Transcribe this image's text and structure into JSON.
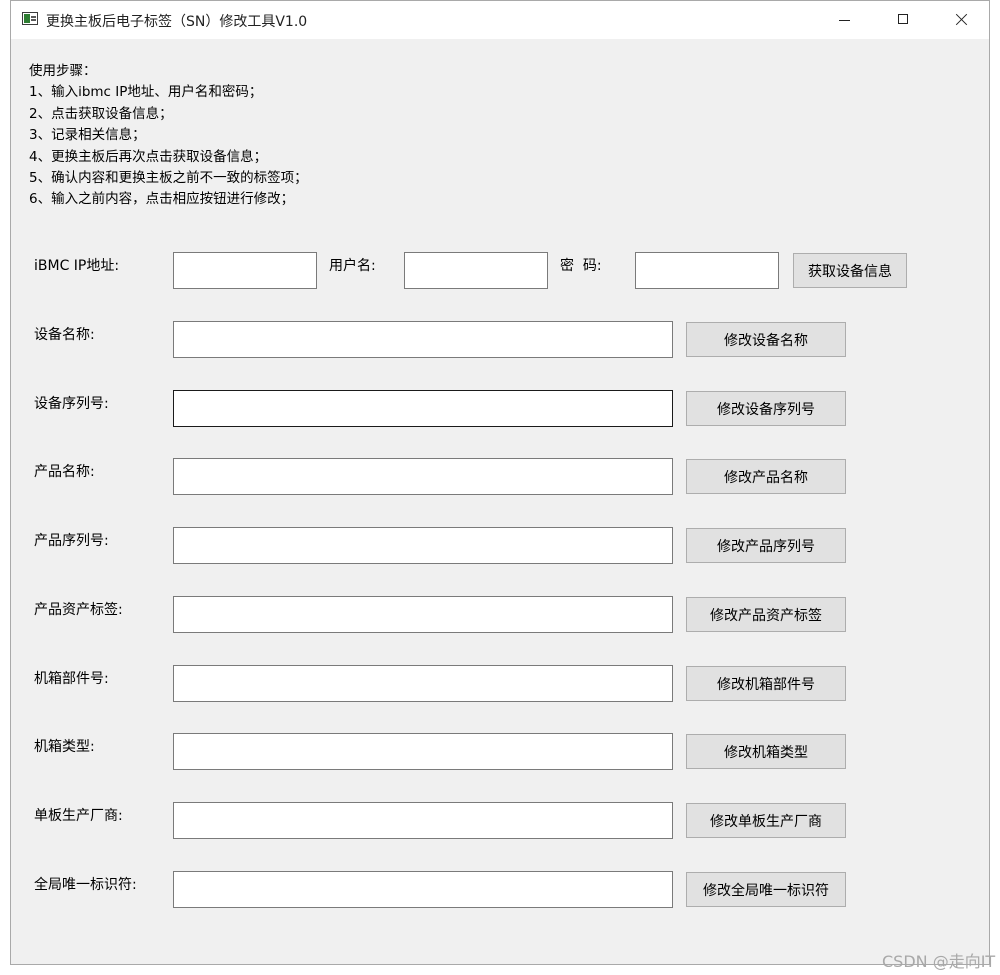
{
  "window": {
    "title": "更换主板后电子标签（SN）修改工具V1.0"
  },
  "instructions": {
    "heading": "使用步骤：",
    "steps": [
      "1、输入ibmc IP地址、用户名和密码；",
      "2、点击获取设备信息；",
      "3、记录相关信息；",
      "4、更换主板后再次点击获取设备信息；",
      "5、确认内容和更换主板之前不一致的标签项；",
      "6、输入之前内容，点击相应按钮进行修改；"
    ]
  },
  "login": {
    "ip_label": "iBMC IP地址:",
    "ip_value": "",
    "user_label": "用户名:",
    "user_value": "",
    "password_label": "密  码:",
    "password_value": "",
    "fetch_button": "获取设备信息"
  },
  "fields": [
    {
      "label": "设备名称:",
      "value": "",
      "button": "修改设备名称"
    },
    {
      "label": "设备序列号:",
      "value": "",
      "button": "修改设备序列号"
    },
    {
      "label": "产品名称:",
      "value": "",
      "button": "修改产品名称"
    },
    {
      "label": "产品序列号:",
      "value": "",
      "button": "修改产品序列号"
    },
    {
      "label": "产品资产标签:",
      "value": "",
      "button": "修改产品资产标签"
    },
    {
      "label": "机箱部件号:",
      "value": "",
      "button": "修改机箱部件号"
    },
    {
      "label": "机箱类型:",
      "value": "",
      "button": "修改机箱类型"
    },
    {
      "label": "单板生产厂商:",
      "value": "",
      "button": "修改单板生产厂商"
    },
    {
      "label": "全局唯一标识符:",
      "value": "",
      "button": "修改全局唯一标识符"
    }
  ],
  "watermark": "CSDN @走向IT"
}
